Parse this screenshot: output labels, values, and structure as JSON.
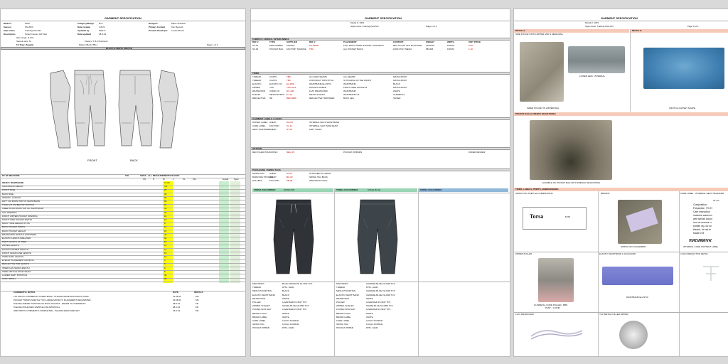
{
  "page1": {
    "title": "GARMENT SPECIFICATION",
    "header_left": [
      {
        "label": "Model #",
        "value": "1003"
      },
      {
        "label": "Season",
        "value": "SS 2024"
      },
      {
        "label": "Style name",
        "value": "Training Pant M's"
      },
      {
        "label": "Description",
        "value": "Stretch woven 3/4 Pant"
      }
    ],
    "header_mid": [
      {
        "label": "Category/Range",
        "value": "Run"
      },
      {
        "label": "Date created",
        "value": "2.8.23"
      },
      {
        "label": "Updated by",
        "value": "Mark S"
      },
      {
        "label": "Date updated",
        "value": "18.8.23"
      }
    ],
    "header_right": [
      {
        "label": "Designer",
        "value": "Marie Schubert"
      },
      {
        "label": "Primary Contact",
        "value": "Kim Bennett"
      },
      {
        "label": "Product Developer",
        "value": "Louise Brown"
      }
    ],
    "size_range": "Size range: S-XXL",
    "sample_size": "Sample size: M",
    "fit_type": "Fit Type: Regular",
    "factory": "Factory: P & N Partnerst",
    "pattern": "Pattern Block: BB-1",
    "page": "Page 1 of 3",
    "sketch_title": "BLACK & WHITE SKETCH",
    "front_label": "FRONT",
    "back_label": "BACK",
    "pom_header": "PT OF MEASURE",
    "tol_header": "TOL",
    "sizes_header": "SIZES - ALL MEASUREMENTS IN CM'S",
    "sizes": [
      "XS",
      "S",
      "M",
      "L",
      "XL",
      "2XL"
    ],
    "grade_label": "Grade",
    "spec_label": "Spec",
    "pom_rows": [
      {
        "name": "WAIST / WAISTBAND",
        "m": "72.00"
      },
      {
        "name": "WAISTBAND HEIGHT",
        "m": "4.5"
      },
      {
        "name": "FRONT RISE",
        "m": "25"
      },
      {
        "name": "BACK RISE",
        "m": "36"
      },
      {
        "name": "INSEAM - LENGTH",
        "m": "58"
      },
      {
        "name": "HIP 7 CM FROM TOP OF WAISTBAND",
        "m": "96"
      },
      {
        "name": "THIGH 2.5 CM BELOW CROTCH",
        "m": "62"
      },
      {
        "name": "KNEE 35 CM FROM TOP OF WAISTBAND",
        "m": "41"
      },
      {
        "name": "LEG OPENING",
        "m": "33"
      },
      {
        "name": "FRONT ZIPPER POCKET OPENING",
        "m": "16"
      },
      {
        "name": "FRONT SIDE POCKET DEPTH",
        "m": "18"
      },
      {
        "name": "BACK YOKE HEIGHT AT CB",
        "m": "8"
      },
      {
        "name": "BACK POCKET WIDTH",
        "m": "14"
      },
      {
        "name": "BACK POCKET HEIGHT",
        "m": "16"
      },
      {
        "name": "DRAWCORD LENGTH (EXPOSED)",
        "m": "40"
      },
      {
        "name": "ELASTIC LENGTH RELAXED",
        "m": "64"
      },
      {
        "name": "DART LENGTH AT KNEE",
        "m": "10"
      },
      {
        "name": "ZIPPER LENGTH",
        "m": "12"
      },
      {
        "name": "POCKET ZIPPER LENGTH",
        "m": "14"
      },
      {
        "name": "FRONT GRAIN LINE LENGTH",
        "m": "15"
      },
      {
        "name": "KNEE DART LENGTH",
        "m": "10"
      },
      {
        "name": "EYELET PLACEMENT FROM CF",
        "m": "3"
      },
      {
        "name": "REFLECTIVE TAB LENGTH",
        "m": "5"
      },
      {
        "name": "INNER LEG SEAM LENGTH",
        "m": "9"
      },
      {
        "name": "KNEE ARTICULATION SEAM",
        "m": "8"
      },
      {
        "name": "LOWER DART POSITION",
        "m": "46"
      },
      {
        "name": "CUFF WIDTH",
        "m": "58"
      }
    ],
    "comments_header": "COMMENTS / NOTES",
    "date_header": "DATE",
    "initials_header": "INITIALS",
    "comments": [
      {
        "text": "1ST PROTO COMMENTS COMPLETED - PLEASE ISSUE 2ND PROTO ASAP",
        "date": "21.08.23",
        "init": "MS"
      },
      {
        "text": "POCKET TOWNS SKETCH TOO LARGE MOVE TO PLACEMENT REQUESTED",
        "date": "24.08.23",
        "init": "MS"
      },
      {
        "text": "PLEASE AMEND POSITION OF BACK POCKET - REFER TO COMMENTS",
        "date": "28.8.23",
        "init": "KB"
      },
      {
        "text": "PLEASE ISSUE RED SAMPLE FOR APPROVAL",
        "date": "08.9.23",
        "init": "KB"
      },
      {
        "text": "3RD PROTO COMMENTS COMPLETED - PLEASE SEND SIZE SET",
        "date": "15.9.23",
        "init": "MS"
      }
    ]
  },
  "page2": {
    "title": "GARMENT SPECIFICATION",
    "model": "Model #: 1003",
    "style": "Style name: Training Pant M's",
    "page": "Page 2 of 3",
    "fabric_header": "FABRICS / LININGS / INTERLININGS",
    "col_headers": [
      "REF #",
      "TYPE",
      "SUPPLIER",
      "REF #",
      "PLACEMENT",
      "CONTENT",
      "WEIGHT",
      "WIDTH",
      "UNIT PRICE"
    ],
    "fabric_rows": [
      {
        "ref": "SF-01",
        "type": "MAIN FABRIC",
        "supplier": "FASTEX",
        "sref": "FS-78225",
        "place": "FULL BODY PANEL EXCEPT CONTRAST",
        "content": "88% NYLON 12% ELASTANE",
        "weight": "145GSM",
        "width": "150CM",
        "price": "5.20"
      },
      {
        "ref": "SF-02",
        "type": "POCKET BAG",
        "supplier": "FACTORY SOURCE",
        "sref": "TBC",
        "place": "ALL POCKET BAGS",
        "content": "100% POLY MESH",
        "weight": "85GSM",
        "width": "150CM",
        "price": "1.10"
      }
    ],
    "trims_header": "TRIMS",
    "trims_rows": [
      {
        "type": "THREAD",
        "supplier": "COATS",
        "ref": "TBC",
        "desc": "ALL MAIN SEAMS",
        "place": "ALL SEAMS",
        "col": "MATCH BODY"
      },
      {
        "type": "THREAD",
        "supplier": "COATS",
        "ref": "TBC",
        "desc": "CONTRAST TOPSTITCH",
        "place": "STITCHING ON THE FRONT",
        "col": "MATCH BODY"
      },
      {
        "type": "ELASTIC",
        "supplier": "ELASTIC CO",
        "ref": "EL-2501",
        "desc": "WAISTBAND ELASTIC",
        "place": "WAISTBAND",
        "col": "BLACK"
      },
      {
        "type": "ZIPPER",
        "supplier": "YKK",
        "ref": "YKK-CN3",
        "desc": "POCKET ZIPPER",
        "place": "FRONT SIDE POCKETS",
        "col": "MATCH BODY"
      },
      {
        "type": "DRAWCORD",
        "supplier": "CORD CO",
        "ref": "DC-440",
        "desc": "FLAT DRAWCORD",
        "place": "WAISTBAND",
        "col": "WHITE"
      },
      {
        "type": "EYELET",
        "supplier": "METALWORKS",
        "ref": "EY-12",
        "desc": "METAL EYELET",
        "place": "WAISTBAND CF",
        "col": "GUNMETAL"
      },
      {
        "type": "REFLECTIVE",
        "supplier": "3M",
        "ref": "REF-8906",
        "desc": "REFLECTIVE TRANSFER",
        "place": "BACK LEG",
        "col": "SILVER"
      }
    ],
    "labels_header": "GARMENT LABELS / LOGOS",
    "labels_rows": [
      {
        "type": "WOVEN LABEL",
        "supplier": "AVERY",
        "ref": "WL-03",
        "place": "INTERNAL BACK WAISTBAND"
      },
      {
        "type": "CARE LABEL",
        "supplier": "FACTORY",
        "ref": "CL-11",
        "place": "INTERNAL LEFT SIDE SEAM"
      },
      {
        "type": "HEAT TRANSFER",
        "supplier": "AVERY",
        "ref": "HT-07",
        "place": "LEFT THIGH"
      }
    ],
    "options_header": "OPTIONS",
    "options_rows": [
      {
        "type": "RECYCLED POLY",
        "supplier": "FASTEX",
        "ref": "REC-45",
        "place": "POCKET ZIPPERS",
        "note": "UNDER REVIEW"
      }
    ],
    "packaging_header": "PACKAGING / SWING TAGS",
    "packaging_rows": [
      {
        "type": "SWING TAG",
        "supplier": "AVERY",
        "ref": "ST-01",
        "place": "ATTACHED TO WAIST"
      },
      {
        "type": "BARCODE STICKER",
        "supplier": "AVERY",
        "ref": "BC-02",
        "place": "SWING TAG BACK"
      },
      {
        "type": "POLYBAG",
        "supplier": "FACTORY",
        "ref": "PB-09",
        "place": "INDIVIDUAL PACK"
      }
    ],
    "colourways": [
      {
        "header": "TORSA COLOURWAY",
        "name": "GRAPHITE",
        "pant_color": "#2f3338"
      },
      {
        "header": "TORSA COLOURWAY",
        "name": "STEEL BLUE",
        "pant_color": "#3e454a"
      },
      {
        "header": "TORSA COLOURWAY",
        "name": "",
        "pant_color": ""
      }
    ],
    "colour_rows": [
      {
        "label": "MAIN BODY",
        "a": "BLUE GRAPHITE 19-4011 TCX",
        "b": "CHINESE BLUE 19-4018 TCX"
      },
      {
        "label": "THREAD",
        "a": "DTM - MAIN",
        "b": "DTM - MAIN"
      },
      {
        "label": "MESH POCKETING",
        "a": "BLACK",
        "b": "CHINESE BLUE 19-4018 TCX"
      },
      {
        "label": "ELASTIC WAIST BAND",
        "a": "BLACK",
        "b": "CHINESE BLUE 19-4018 TCX"
      },
      {
        "label": "DRAWCORD",
        "a": "WHITE",
        "b": "WHITE"
      },
      {
        "label": "PULLER",
        "a": "LAVENDER 15-3817 TPX",
        "b": "LAVENDER 15-3817 TPX"
      },
      {
        "label": "ZIPPER / EYELET",
        "a": "SHARE BLUE 18-4250 TCX",
        "b": "SHARE BLUE 18-4250 TCX"
      },
      {
        "label": "PLATED NON-SLIP",
        "a": "LAVENDER 15-3817 TPX",
        "b": "LAVENDER 15-3817 TPX"
      },
      {
        "label": "BRAND LOGO",
        "a": "WHITE",
        "b": "WHITE"
      },
      {
        "label": "BRAND LABEL",
        "a": "WHITE",
        "b": "WHITE"
      },
      {
        "label": "CARE LABEL",
        "a": "LOCAL SOURCE",
        "b": "LOCAL SOURCE"
      },
      {
        "label": "SWING TAG",
        "a": "LOCAL SOURCE",
        "b": "LOCAL SOURCE"
      },
      {
        "label": "POCKET ZIPPER",
        "a": "DTM - MAIN",
        "b": "DTM - MAIN"
      }
    ]
  },
  "page3": {
    "title": "GARMENT SPECIFICATION",
    "model": "Model #: 1003",
    "style": "Style name: Training Pant M's",
    "page": "Page 3 of 3",
    "detail_a": "DETAIL A",
    "detail_b": "DETAIL B",
    "detail_a_sub": "SIDE POCKET WITH ZIPPER AND & MESH BAG",
    "cap1": "INNER POCKET IN ZIPPER BAG",
    "cap2": "LOWER HEM - INTERNAL",
    "cap3": "CROTCH GUSSET SHAPE",
    "detail_c": "POCKET BAG & FRENCH SEAM FINISH",
    "cap4": "EXAMPLE OF POCKET BAG WITH FRENCH SEAM FINISH",
    "trims_header": "TRIMS, LABELS, PRINTS, EMBROIDERIES",
    "swing_tag_header": "SWING TAG SKETCH & DIMENSIONS",
    "brand_header": "BRANDS",
    "care_header": "CARE LABEL - INTERNAL HEAT TRANSFER",
    "swing_brand": "Torsa",
    "swing_size": "M/48",
    "cap5": "SWING TAG PLACEMENT",
    "care_dim": "33 mm",
    "care_lines": [
      "Composition:",
      "Polyamide, 7% El",
      "Care instruction",
      "machine wash inv",
      "with similar colour",
      "iron on reverse, c",
      "tumble dry, do no",
      "bleach, do not dr",
      "Made in B"
    ],
    "care_brand": "SNOWMAK",
    "cap6": "INTERNAL CARE CONTENT LABEL",
    "zipper_header": "ZIPPER PULLER",
    "elastic_header": "ELASTIC WAISTBAND & JACQUARD",
    "reflective_header": "LOGO REFLECTIVE DETAIL",
    "cap7": "GUNMETAL CORD PULLER - BBN",
    "cap7b": "PANT - YLOND",
    "cap8": "WAISTBAND ELASTIC",
    "drawcord_header": "FLAT DRAWCORD",
    "eyelet_header": "YKK METAL PULLER ZIPPER"
  }
}
